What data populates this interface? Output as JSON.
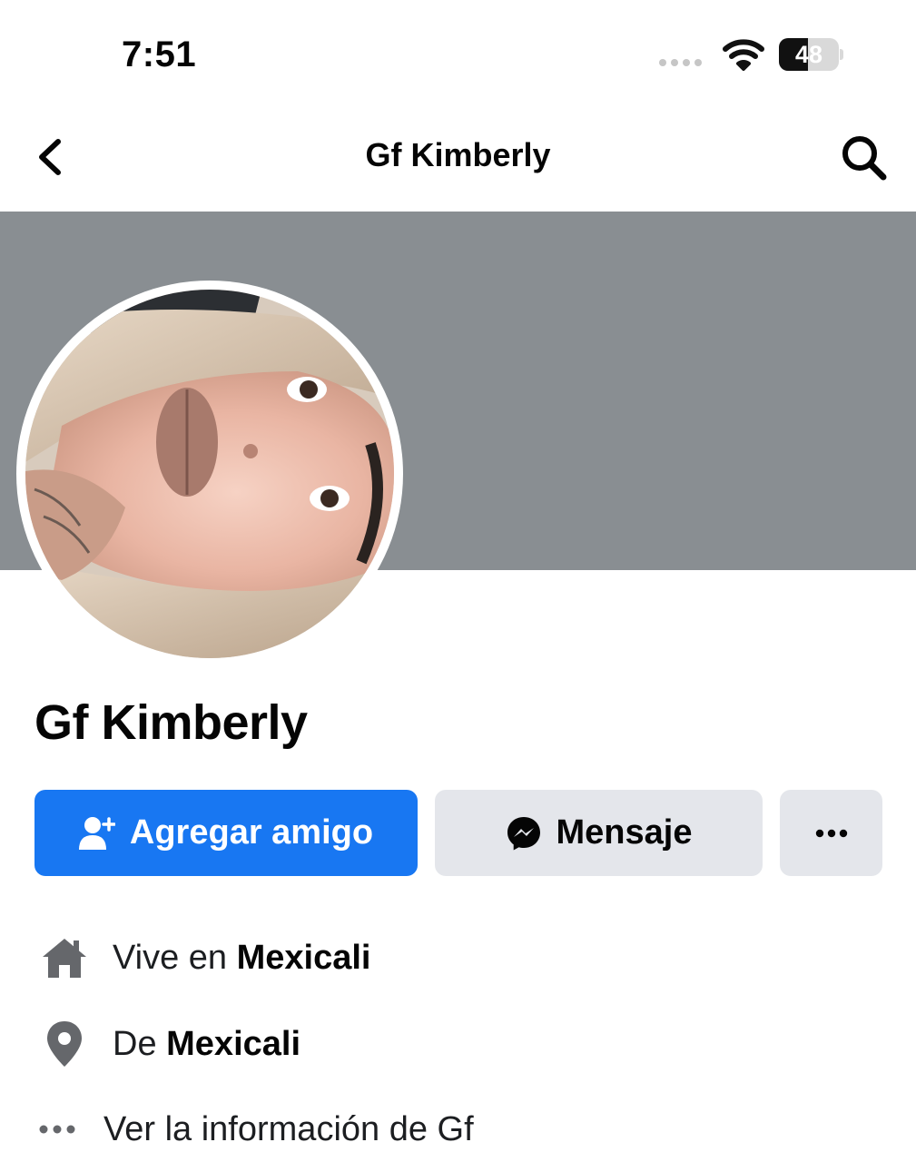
{
  "status_bar": {
    "time": "7:51",
    "battery_level": "48",
    "battery_fraction": 0.48
  },
  "header": {
    "title": "Gf Kimberly",
    "back_icon": "chevron-left-icon",
    "search_icon": "search-icon"
  },
  "profile": {
    "name": "Gf Kimberly",
    "cover_color": "#898e92"
  },
  "actions": {
    "add_friend_label": "Agregar amigo",
    "message_label": "Mensaje",
    "more_icon": "ellipsis-icon",
    "primary_color": "#1877f2",
    "secondary_color": "#e4e6eb"
  },
  "info": {
    "lives_prefix": "Vive en",
    "lives_city": "Mexicali",
    "from_prefix": "De",
    "from_city": "Mexicali",
    "see_info": "Ver la información de Gf"
  }
}
